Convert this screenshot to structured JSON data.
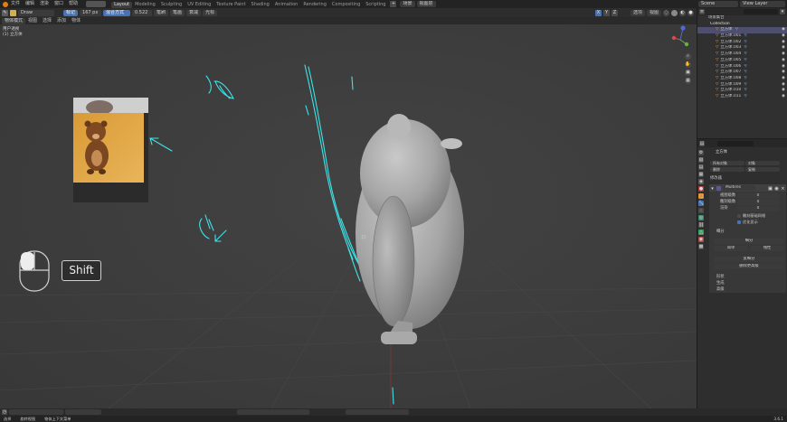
{
  "topbar": {
    "menus": [
      "文件",
      "编辑",
      "渲染",
      "窗口",
      "帮助"
    ],
    "workspace_tabs": [
      "Layout",
      "Modeling",
      "Sculpting",
      "UV Editing",
      "Texture Paint",
      "Shading",
      "Animation",
      "Rendering",
      "Compositing",
      "Scripting"
    ],
    "active_tab": "Layout",
    "scene_label": "Scene",
    "view_layer_label": "View Layer",
    "right_buttons": [
      "场景",
      "视图层"
    ]
  },
  "toolbar": {
    "mode_value": "Draw",
    "tool_value": "标记",
    "radius_value": "167 px",
    "strength_label": "强度",
    "strength_value": "0.522",
    "blend_label": "混合方式",
    "menus": [
      "笔刷",
      "笔画",
      "衰减",
      "光标"
    ],
    "right_labels": [
      "选项",
      "视图"
    ]
  },
  "vheader": {
    "menus": [
      "物体模式",
      "视图",
      "选择",
      "添加",
      "物体"
    ],
    "overlay_label": "用户透视",
    "collection_label": "(1) 立方体"
  },
  "viewport": {
    "gizmo_axes": {
      "x": "X",
      "y": "Y",
      "z": "Z"
    },
    "shift_key": "Shift"
  },
  "outliner": {
    "header_label": "场景集合",
    "collection": "Collection",
    "items": [
      "立方体",
      "立方体.001",
      "立方体.002",
      "立方体.003",
      "立方体.004",
      "立方体.005",
      "立方体.006",
      "立方体.007",
      "立方体.008",
      "立方体.009",
      "立方体.010",
      "立方体.011"
    ],
    "selected_index": 0
  },
  "properties": {
    "object_name": "立方体",
    "tabs_row1": [
      "所有对象",
      "对象",
      "删除",
      "复制"
    ],
    "section_label": "修改器",
    "modifier_name": "Multires",
    "fields": [
      {
        "label": "视图级数",
        "value": "0"
      },
      {
        "label": "雕刻级数",
        "value": "0"
      },
      {
        "label": "渲染",
        "value": "0"
      }
    ],
    "checkbox_1": "雕刻基础网格",
    "checkbox_2": "优化显示",
    "subsection_label": "细分",
    "buttons": [
      "细分",
      "简单",
      "线性",
      "反细分",
      "删除更高级"
    ],
    "collapsed": [
      "形状",
      "生成",
      "高级"
    ]
  },
  "statusbar": {
    "items": [
      "选择",
      "旋转视图",
      "物体上下文菜单"
    ],
    "version": "3.6.1"
  }
}
